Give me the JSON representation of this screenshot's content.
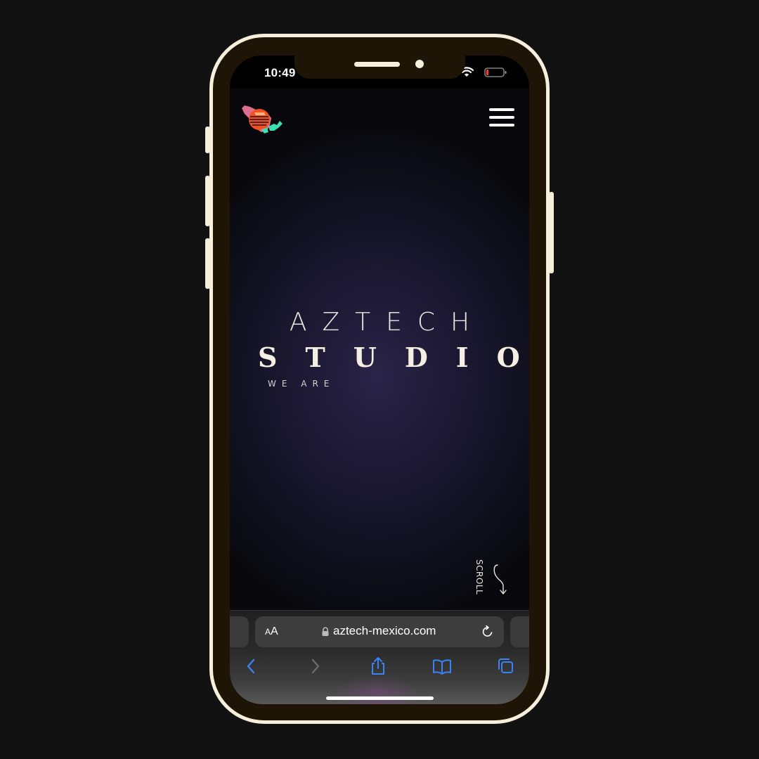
{
  "status_bar": {
    "time": "10:49"
  },
  "hero": {
    "line1": "AZTECH",
    "line2": "STUDIO",
    "line3": "WE ARE"
  },
  "scroll_hint": {
    "label": "SCROLL"
  },
  "browser": {
    "text_size_small": "A",
    "text_size_big": "A",
    "url": "aztech-mexico.com"
  },
  "colors": {
    "phone_frame": "#f6efdc",
    "phone_body": "#1e1506",
    "background": "#121212",
    "hero_text": "#f4efe2",
    "safari_accent": "#3b82f6"
  },
  "icons": [
    "logo-icon",
    "menu-icon",
    "wifi-icon",
    "battery-icon",
    "lock-icon",
    "reload-icon",
    "back-icon",
    "forward-icon",
    "share-icon",
    "bookmarks-icon",
    "tabs-icon",
    "scroll-arrow-icon"
  ]
}
